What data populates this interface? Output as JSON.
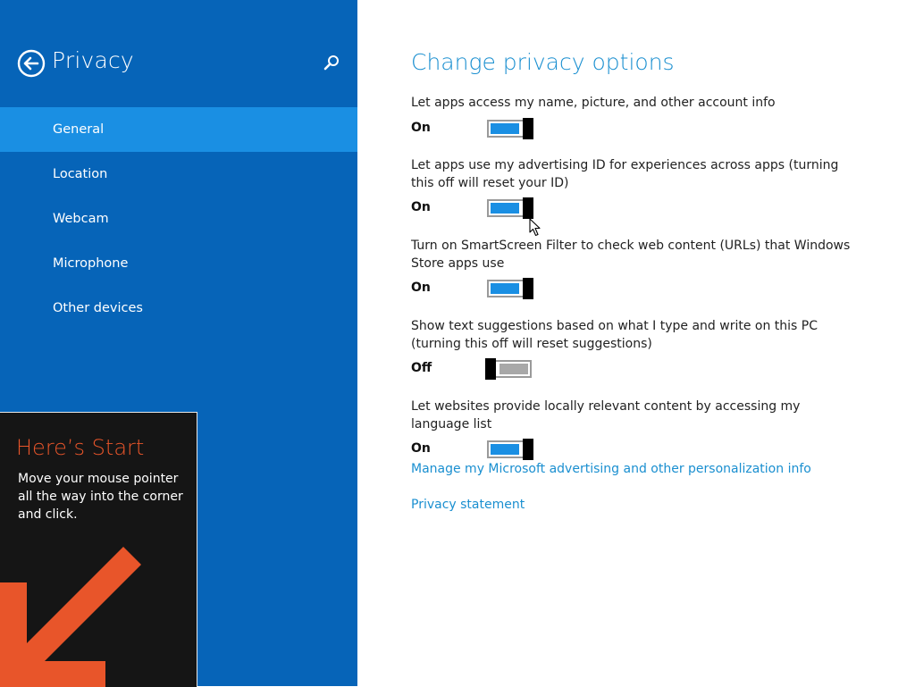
{
  "sidebar": {
    "title": "Privacy",
    "back_icon": "back-arrow-icon",
    "search_icon": "search-icon",
    "items": [
      {
        "label": "General",
        "selected": true
      },
      {
        "label": "Location",
        "selected": false
      },
      {
        "label": "Webcam",
        "selected": false
      },
      {
        "label": "Microphone",
        "selected": false
      },
      {
        "label": "Other devices",
        "selected": false
      }
    ]
  },
  "start_tip": {
    "title": "Here’s Start",
    "body": "Move your mouse pointer all the way into the corner and click.",
    "arrow_icon": "down-left-arrow-icon"
  },
  "main": {
    "title": "Change privacy options",
    "settings": [
      {
        "label": "Let apps access my name, picture, and other account info",
        "state": "On",
        "on": true
      },
      {
        "label": "Let apps use my advertising ID for experiences across apps (turning this off will reset your ID)",
        "state": "On",
        "on": true
      },
      {
        "label": "Turn on SmartScreen Filter to check web content (URLs) that Windows Store apps use",
        "state": "On",
        "on": true
      },
      {
        "label": "Show text suggestions based on what I type and write on this PC (turning this off will reset suggestions)",
        "state": "Off",
        "on": false
      },
      {
        "label": "Let websites provide locally relevant content by accessing my language list",
        "state": "On",
        "on": true
      }
    ],
    "links": {
      "advertising": "Manage my Microsoft advertising and other personalization info",
      "privacy_statement": "Privacy statement"
    }
  },
  "colors": {
    "sidebar_bg": "#0664b8",
    "selected_item": "#1a8fe3",
    "accent": "#1a8fd0",
    "toggle_on": "#1a8fe3",
    "toggle_off": "#a8a8a8",
    "tip_title": "#e8552a"
  }
}
